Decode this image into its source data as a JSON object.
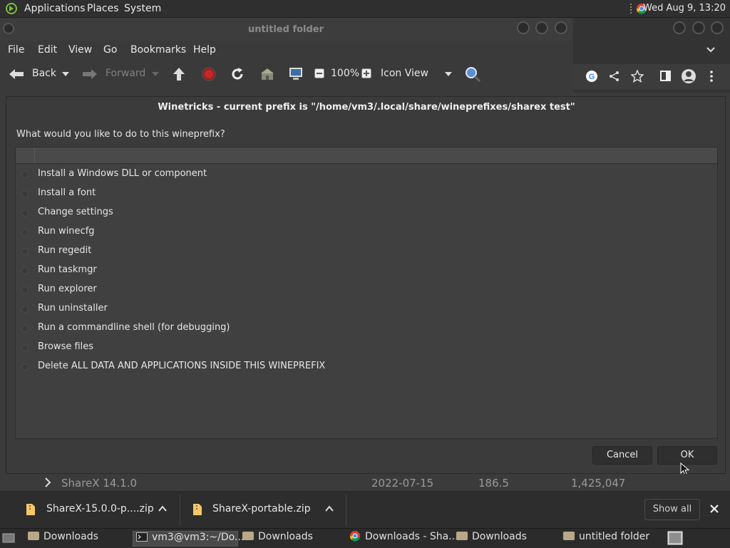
{
  "top_panel": {
    "menus": [
      "Applications",
      "Places",
      "System"
    ],
    "clock": "Wed Aug  9, 13:20"
  },
  "file_manager": {
    "title": "untitled folder",
    "menubar": [
      "File",
      "Edit",
      "View",
      "Go",
      "Bookmarks",
      "Help"
    ],
    "toolbar": {
      "back": "Back",
      "forward": "Forward",
      "zoom": "100%",
      "view_mode": "Icon View"
    }
  },
  "dialog": {
    "title": "Winetricks - current prefix is \"/home/vm3/.local/share/wineprefixes/sharex test\"",
    "question": "What would you like to do to this wineprefix?",
    "options": [
      "Install a Windows DLL or component",
      "Install a font",
      "Change settings",
      "Run winecfg",
      "Run regedit",
      "Run taskmgr",
      "Run explorer",
      "Run uninstaller",
      "Run a commandline shell (for debugging)",
      "Browse files",
      "Delete ALL DATA AND APPLICATIONS INSIDE THIS WINEPREFIX"
    ],
    "cancel_label": "Cancel",
    "ok_label": "OK"
  },
  "background_row": {
    "name": "ShareX 14.1.0",
    "date": "2022-07-15",
    "size": "186.5",
    "bytes": "1,425,047"
  },
  "download_bar": {
    "items": [
      "ShareX-15.0.0-p....zip",
      "ShareX-portable.zip"
    ],
    "show_all": "Show all"
  },
  "taskbar": {
    "tasks": [
      "Downloads",
      "vm3@vm3:~/Do...",
      "Downloads",
      "Downloads - Sha...",
      "Downloads",
      "untitled folder"
    ]
  }
}
